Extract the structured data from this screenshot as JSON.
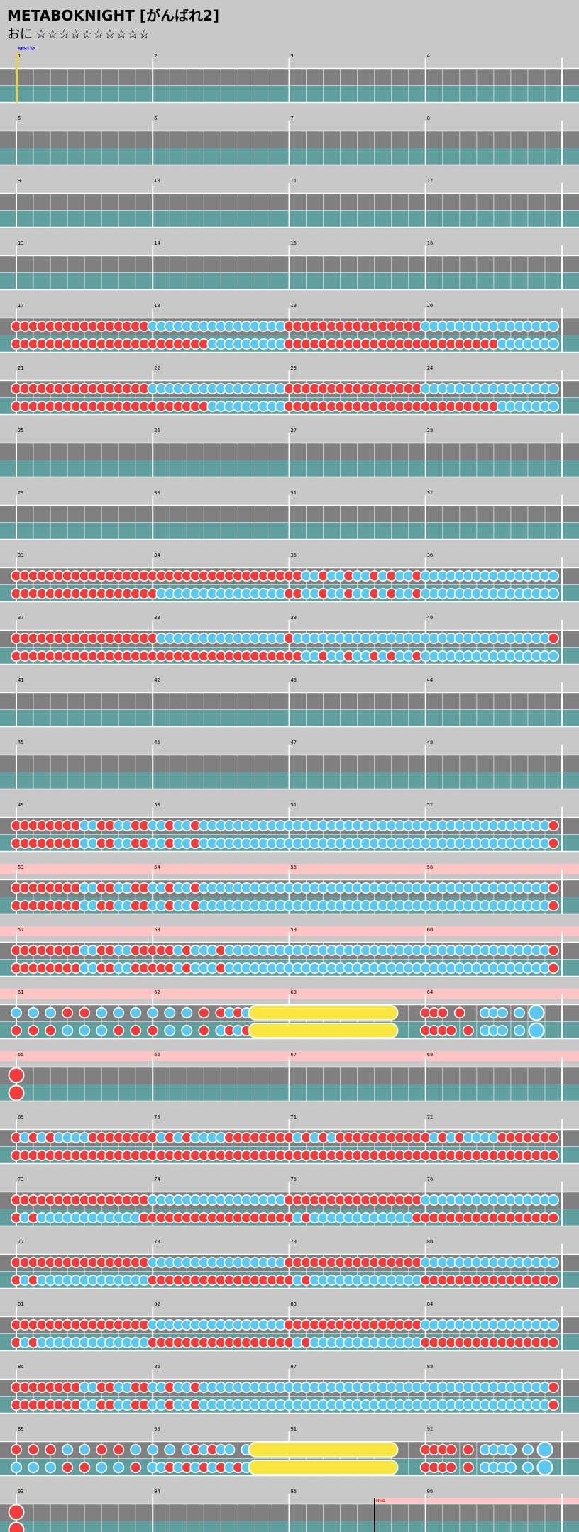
{
  "song": {
    "title": "METABOKNIGHT",
    "course": "がんばれ2",
    "difficulty_label": "おに",
    "stars": "☆☆☆☆☆☆☆☆☆☆"
  },
  "colors": {
    "background": "#c8c8c8",
    "lane_gray": "#808080",
    "lane_teal": "#5f9f9f",
    "gogo_pink": "#ffc4c4",
    "don_red": "#f23c3c",
    "ka_blue": "#5ac8f0",
    "drumroll_yellow": "#fae641",
    "bpm_marker": "#0000ff",
    "scroll_marker": "#ff0000"
  },
  "markers": {
    "bpm": "BPM150",
    "scroll": "HS4"
  },
  "pattern_legend": {
    "d": "don (red)",
    "k": "ka (blue)",
    "-": "rest",
    "=": "drumroll"
  },
  "measures": {
    "17": [
      "dddddddddddddddd",
      "dddddddddddddddd"
    ],
    "18": [
      "kkkkkkkkkkkkkkkk",
      "dddddddkkkkkkkkk"
    ],
    "19": [
      "dddddddddddddddd",
      "dddddddddddddddd"
    ],
    "20": [
      "kkkkkkkkkkkkkkkk",
      "dddddddddkkkkkkk"
    ],
    "21": [
      "dddddddddddddddd",
      "dddddddddddddddd"
    ],
    "22": [
      "kkkkkkkkkkkkkkkk",
      "dddddddkkkkkkkkk"
    ],
    "23": [
      "dddddddddddddddd",
      "dddddddddddddddd"
    ],
    "24": [
      "kkkkkkkkkkkkkkkk",
      "dddddddddkkkkkkk"
    ],
    "33": [
      "dddddddddddddddd",
      "dddddddddddddddd"
    ],
    "34": [
      "dddddddddddddddd",
      "dkkkkkkkkkkkkkkk"
    ],
    "35": [
      "ddkkdkkdkkdkdkkd",
      "ddkkdkkdkkdkdkkd"
    ],
    "36": [
      "kkkkkkkkkkkkkkkk",
      "kkkkkkkkkkkkkkkk"
    ],
    "37": [
      "dddddddddddddddd",
      "dddddddddddddddd"
    ],
    "38": [
      "dkkkkkkkkkkkkkkk",
      "dddddddddddddddd"
    ],
    "39": [
      "dkkkkkkkkkkkkkkk",
      "ddkkdkkdkkdkdkkd"
    ],
    "40": [
      "kkkkkkkkkkkkkkkd",
      "kkkkkkkkkkkkkkkk"
    ],
    "49": [
      "ddddddddkkddkkdd",
      "ddddddddkkddkkdd"
    ],
    "50": [
      "kkdkkdkkkkkkkkkk",
      "kkdkkdkkkkkkkkkk"
    ],
    "51": [
      "kkkkkkkkkkkkkkkk",
      "kkkkkkkkkkkkkkkk"
    ],
    "52": [
      "kkkkkkkkkkkkkkkd",
      "kkkkkkkkkkkkkkkd"
    ],
    "53": [
      "ddddddddkkddkkdd",
      "ddddddddkkddkkdd"
    ],
    "54": [
      "kkdkkdkkkkkkkkkk",
      "kkdkkdkkkkkkkkkk"
    ],
    "55": [
      "kkkkkkkkkkkkkkkk",
      "kkkkkkkkkkkkkkkk"
    ],
    "56": [
      "kkkkkkkkkkkkkkkd",
      "kkkkkkkkkkkkkkkd"
    ],
    "57": [
      "ddddddddkkddkkdd",
      "ddddddddkkddkkdd"
    ],
    "58": [
      "dddkdkkkdkkkkkkk",
      "dddkdkkkdkkkkkkk"
    ],
    "59": [
      "kkkkkkkkkkkkkkkk",
      "kkkkkkkkkkkkkkkk"
    ],
    "60": [
      "kkkkkkkkkkkkkkkd",
      "kkkkkkkkkkkkkkkd"
    ],
    "61": [
      "k-k-k-d-d-k-k-k-",
      "d-d-d-k-k-k-d-d-"
    ],
    "62": [
      "k-k-k-d-dkdk====",
      "d-k-k-d-kdkd===="
    ],
    "63": [
      "================",
      "================"
    ],
    "64": [
      "ddd-d--kkk-k-K--",
      "dddd-d-kkk-k-K--"
    ],
    "65": [
      "D---------------",
      "D---------------"
    ],
    "69": [
      "dkdkdkkkkddddddd",
      "dddddddddddddddd"
    ],
    "70": [
      "dkdkdkkkkddddddd",
      "dddddddddddddddd"
    ],
    "71": [
      "dkdkdkdddddddddd",
      "dddddddddddddddd"
    ],
    "72": [
      "dkdkdkkkkddddddd",
      "dddddddddddddddd"
    ],
    "73": [
      "dddddddddddddddd",
      "dkdkkkkkkkkkkkkd"
    ],
    "74": [
      "kkkkkkkkkkkkkkkk",
      "dddddddddddddddd"
    ],
    "75": [
      "dddddddddddddddd",
      "dkdkkkkkkkkkkkkd"
    ],
    "76": [
      "kkkkkkkkkkkkkkkk",
      "dddddddddddddddd"
    ],
    "77": [
      "dddddddddddddddd",
      "dkdkkkkkkkkkkkkk"
    ],
    "78": [
      "kkkkkkkkkkkkkkkk",
      "dddddddddddddddd"
    ],
    "79": [
      "dddddddddddddddd",
      "dkdkkkkkkkkkkkkk"
    ],
    "80": [
      "kkkkkkkkkkkkkkkk",
      "dddddddddddddddd"
    ],
    "81": [
      "dddddddddddddddd",
      "dkdkkkkkkkkkkkkk"
    ],
    "82": [
      "kkkkkkkkkkkkkkkk",
      "dddddddddddddddd"
    ],
    "83": [
      "dddddddddddddddd",
      "dkdkkkkkkkkkkkkk"
    ],
    "84": [
      "kkkkkkkkkkkkkkkk",
      "dddddddddddddddd"
    ],
    "85": [
      "ddddddddkkddkkdd",
      "ddddddddkkddkkdd"
    ],
    "86": [
      "kkdkkdkkkkkkkkkk",
      "kkdkkdkkkkkkkkkk"
    ],
    "87": [
      "kkkkkkkkkkkkkkkk",
      "kkkkkkkkkkkkkkkk"
    ],
    "88": [
      "kkkkkkkkkkkkkkkd",
      "kkkkkkkkkkkkkkkd"
    ],
    "89": [
      "d-d-d-k-k-d-d-k-",
      "k-k-k-d-d-k-k-d-"
    ],
    "90": [
      "k-k-kdkdkk-k====",
      "kkdkdkdkdkdk===="
    ],
    "91": [
      "================",
      "================"
    ],
    "92": [
      "dddd-d-kkkk-k-K-",
      "dddd-d-kkkk-k-K-"
    ],
    "93": [
      "D---------------",
      "D---------------"
    ]
  },
  "gogo_rows": [
    13,
    14,
    15,
    16,
    24
  ]
}
